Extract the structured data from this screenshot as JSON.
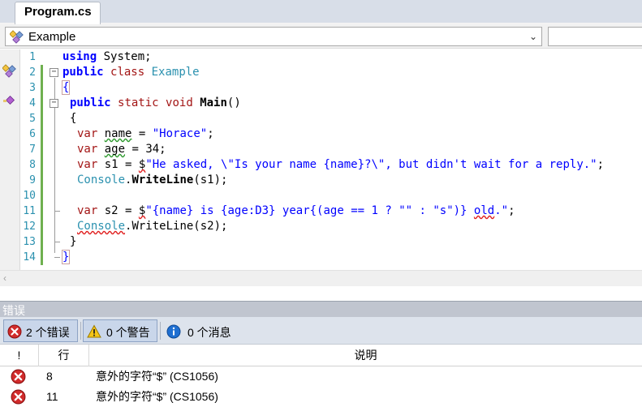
{
  "tab": {
    "title": "Program.cs"
  },
  "nav": {
    "class_selector": "Example"
  },
  "editor": {
    "line_numbers": [
      "1",
      "2",
      "3",
      "4",
      "5",
      "6",
      "7",
      "8",
      "9",
      "10",
      "11",
      "12",
      "13",
      "14"
    ],
    "code": {
      "l1_kw": "using",
      "l1_rest": " System;",
      "l2_kw": "public",
      "l2_kw2": "class",
      "l2_name": "Example",
      "l3": "{",
      "l4_kw": "public",
      "l4_kw2": "static",
      "l4_kw3": "void",
      "l4_name": "Main",
      "l4_rest": "()",
      "l5": "{",
      "l6_kw": "var",
      "l6_var": "name",
      "l6_eq": " = ",
      "l6_str": "\"Horace\"",
      "l6_end": ";",
      "l7_kw": "var",
      "l7_var": "age",
      "l7_rest": " = 34;",
      "l8_kw": "var",
      "l8_mid": " s1 = ",
      "l8_dollar": "$",
      "l8_str": "\"He asked, \\\"Is your name {name}?\\\", but didn't wait for a reply.\"",
      "l8_end": ";",
      "l9_type": "Console",
      "l9_dot": ".",
      "l9_method": "WriteLine",
      "l9_rest": "(s1);",
      "l11_kw": "var",
      "l11_var": "s2",
      "l11_eq": " = ",
      "l11_dollar": "$",
      "l11_str": "\"{name} is {age:D3} year{(age == 1 ? \"\" : \"s\")} ",
      "l11_old": "old",
      "l11_tail": ".\"",
      "l11_end": ";",
      "l12_type": "Console",
      "l12_rest": ".WriteLine(s2);",
      "l13": "}",
      "l14": "}"
    }
  },
  "errors_panel": {
    "title": "错误",
    "filters": {
      "errors": "2 个错误",
      "warnings": "0 个警告",
      "messages": "0 个消息"
    },
    "columns": {
      "severity": "!",
      "line": "行",
      "description": "说明"
    },
    "rows": [
      {
        "line": "8",
        "description": "意外的字符“$” (CS1056)"
      },
      {
        "line": "11",
        "description": "意外的字符“$” (CS1056)"
      }
    ]
  },
  "colors": {
    "keyword": "#0000ff",
    "type": "#2b91af",
    "string": "#a31515",
    "change_bar": "#6fb050",
    "error_red": "#d12b2b"
  }
}
